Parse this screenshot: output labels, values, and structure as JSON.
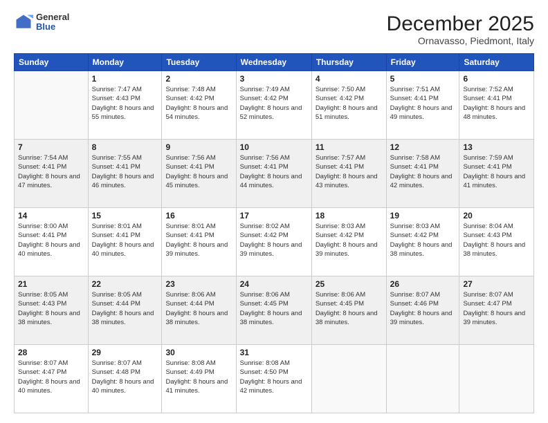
{
  "header": {
    "logo_general": "General",
    "logo_blue": "Blue",
    "title": "December 2025",
    "subtitle": "Ornavasso, Piedmont, Italy"
  },
  "days_of_week": [
    "Sunday",
    "Monday",
    "Tuesday",
    "Wednesday",
    "Thursday",
    "Friday",
    "Saturday"
  ],
  "weeks": [
    [
      {
        "day": "",
        "sunrise": "",
        "sunset": "",
        "daylight": ""
      },
      {
        "day": "1",
        "sunrise": "Sunrise: 7:47 AM",
        "sunset": "Sunset: 4:43 PM",
        "daylight": "Daylight: 8 hours and 55 minutes."
      },
      {
        "day": "2",
        "sunrise": "Sunrise: 7:48 AM",
        "sunset": "Sunset: 4:42 PM",
        "daylight": "Daylight: 8 hours and 54 minutes."
      },
      {
        "day": "3",
        "sunrise": "Sunrise: 7:49 AM",
        "sunset": "Sunset: 4:42 PM",
        "daylight": "Daylight: 8 hours and 52 minutes."
      },
      {
        "day": "4",
        "sunrise": "Sunrise: 7:50 AM",
        "sunset": "Sunset: 4:42 PM",
        "daylight": "Daylight: 8 hours and 51 minutes."
      },
      {
        "day": "5",
        "sunrise": "Sunrise: 7:51 AM",
        "sunset": "Sunset: 4:41 PM",
        "daylight": "Daylight: 8 hours and 49 minutes."
      },
      {
        "day": "6",
        "sunrise": "Sunrise: 7:52 AM",
        "sunset": "Sunset: 4:41 PM",
        "daylight": "Daylight: 8 hours and 48 minutes."
      }
    ],
    [
      {
        "day": "7",
        "sunrise": "Sunrise: 7:54 AM",
        "sunset": "Sunset: 4:41 PM",
        "daylight": "Daylight: 8 hours and 47 minutes."
      },
      {
        "day": "8",
        "sunrise": "Sunrise: 7:55 AM",
        "sunset": "Sunset: 4:41 PM",
        "daylight": "Daylight: 8 hours and 46 minutes."
      },
      {
        "day": "9",
        "sunrise": "Sunrise: 7:56 AM",
        "sunset": "Sunset: 4:41 PM",
        "daylight": "Daylight: 8 hours and 45 minutes."
      },
      {
        "day": "10",
        "sunrise": "Sunrise: 7:56 AM",
        "sunset": "Sunset: 4:41 PM",
        "daylight": "Daylight: 8 hours and 44 minutes."
      },
      {
        "day": "11",
        "sunrise": "Sunrise: 7:57 AM",
        "sunset": "Sunset: 4:41 PM",
        "daylight": "Daylight: 8 hours and 43 minutes."
      },
      {
        "day": "12",
        "sunrise": "Sunrise: 7:58 AM",
        "sunset": "Sunset: 4:41 PM",
        "daylight": "Daylight: 8 hours and 42 minutes."
      },
      {
        "day": "13",
        "sunrise": "Sunrise: 7:59 AM",
        "sunset": "Sunset: 4:41 PM",
        "daylight": "Daylight: 8 hours and 41 minutes."
      }
    ],
    [
      {
        "day": "14",
        "sunrise": "Sunrise: 8:00 AM",
        "sunset": "Sunset: 4:41 PM",
        "daylight": "Daylight: 8 hours and 40 minutes."
      },
      {
        "day": "15",
        "sunrise": "Sunrise: 8:01 AM",
        "sunset": "Sunset: 4:41 PM",
        "daylight": "Daylight: 8 hours and 40 minutes."
      },
      {
        "day": "16",
        "sunrise": "Sunrise: 8:01 AM",
        "sunset": "Sunset: 4:41 PM",
        "daylight": "Daylight: 8 hours and 39 minutes."
      },
      {
        "day": "17",
        "sunrise": "Sunrise: 8:02 AM",
        "sunset": "Sunset: 4:42 PM",
        "daylight": "Daylight: 8 hours and 39 minutes."
      },
      {
        "day": "18",
        "sunrise": "Sunrise: 8:03 AM",
        "sunset": "Sunset: 4:42 PM",
        "daylight": "Daylight: 8 hours and 39 minutes."
      },
      {
        "day": "19",
        "sunrise": "Sunrise: 8:03 AM",
        "sunset": "Sunset: 4:42 PM",
        "daylight": "Daylight: 8 hours and 38 minutes."
      },
      {
        "day": "20",
        "sunrise": "Sunrise: 8:04 AM",
        "sunset": "Sunset: 4:43 PM",
        "daylight": "Daylight: 8 hours and 38 minutes."
      }
    ],
    [
      {
        "day": "21",
        "sunrise": "Sunrise: 8:05 AM",
        "sunset": "Sunset: 4:43 PM",
        "daylight": "Daylight: 8 hours and 38 minutes."
      },
      {
        "day": "22",
        "sunrise": "Sunrise: 8:05 AM",
        "sunset": "Sunset: 4:44 PM",
        "daylight": "Daylight: 8 hours and 38 minutes."
      },
      {
        "day": "23",
        "sunrise": "Sunrise: 8:06 AM",
        "sunset": "Sunset: 4:44 PM",
        "daylight": "Daylight: 8 hours and 38 minutes."
      },
      {
        "day": "24",
        "sunrise": "Sunrise: 8:06 AM",
        "sunset": "Sunset: 4:45 PM",
        "daylight": "Daylight: 8 hours and 38 minutes."
      },
      {
        "day": "25",
        "sunrise": "Sunrise: 8:06 AM",
        "sunset": "Sunset: 4:45 PM",
        "daylight": "Daylight: 8 hours and 38 minutes."
      },
      {
        "day": "26",
        "sunrise": "Sunrise: 8:07 AM",
        "sunset": "Sunset: 4:46 PM",
        "daylight": "Daylight: 8 hours and 39 minutes."
      },
      {
        "day": "27",
        "sunrise": "Sunrise: 8:07 AM",
        "sunset": "Sunset: 4:47 PM",
        "daylight": "Daylight: 8 hours and 39 minutes."
      }
    ],
    [
      {
        "day": "28",
        "sunrise": "Sunrise: 8:07 AM",
        "sunset": "Sunset: 4:47 PM",
        "daylight": "Daylight: 8 hours and 40 minutes."
      },
      {
        "day": "29",
        "sunrise": "Sunrise: 8:07 AM",
        "sunset": "Sunset: 4:48 PM",
        "daylight": "Daylight: 8 hours and 40 minutes."
      },
      {
        "day": "30",
        "sunrise": "Sunrise: 8:08 AM",
        "sunset": "Sunset: 4:49 PM",
        "daylight": "Daylight: 8 hours and 41 minutes."
      },
      {
        "day": "31",
        "sunrise": "Sunrise: 8:08 AM",
        "sunset": "Sunset: 4:50 PM",
        "daylight": "Daylight: 8 hours and 42 minutes."
      },
      {
        "day": "",
        "sunrise": "",
        "sunset": "",
        "daylight": ""
      },
      {
        "day": "",
        "sunrise": "",
        "sunset": "",
        "daylight": ""
      },
      {
        "day": "",
        "sunrise": "",
        "sunset": "",
        "daylight": ""
      }
    ]
  ],
  "colors": {
    "header_bg": "#2255bb",
    "header_text": "#ffffff",
    "shaded_row": "#f0f0f0",
    "white_row": "#ffffff"
  }
}
